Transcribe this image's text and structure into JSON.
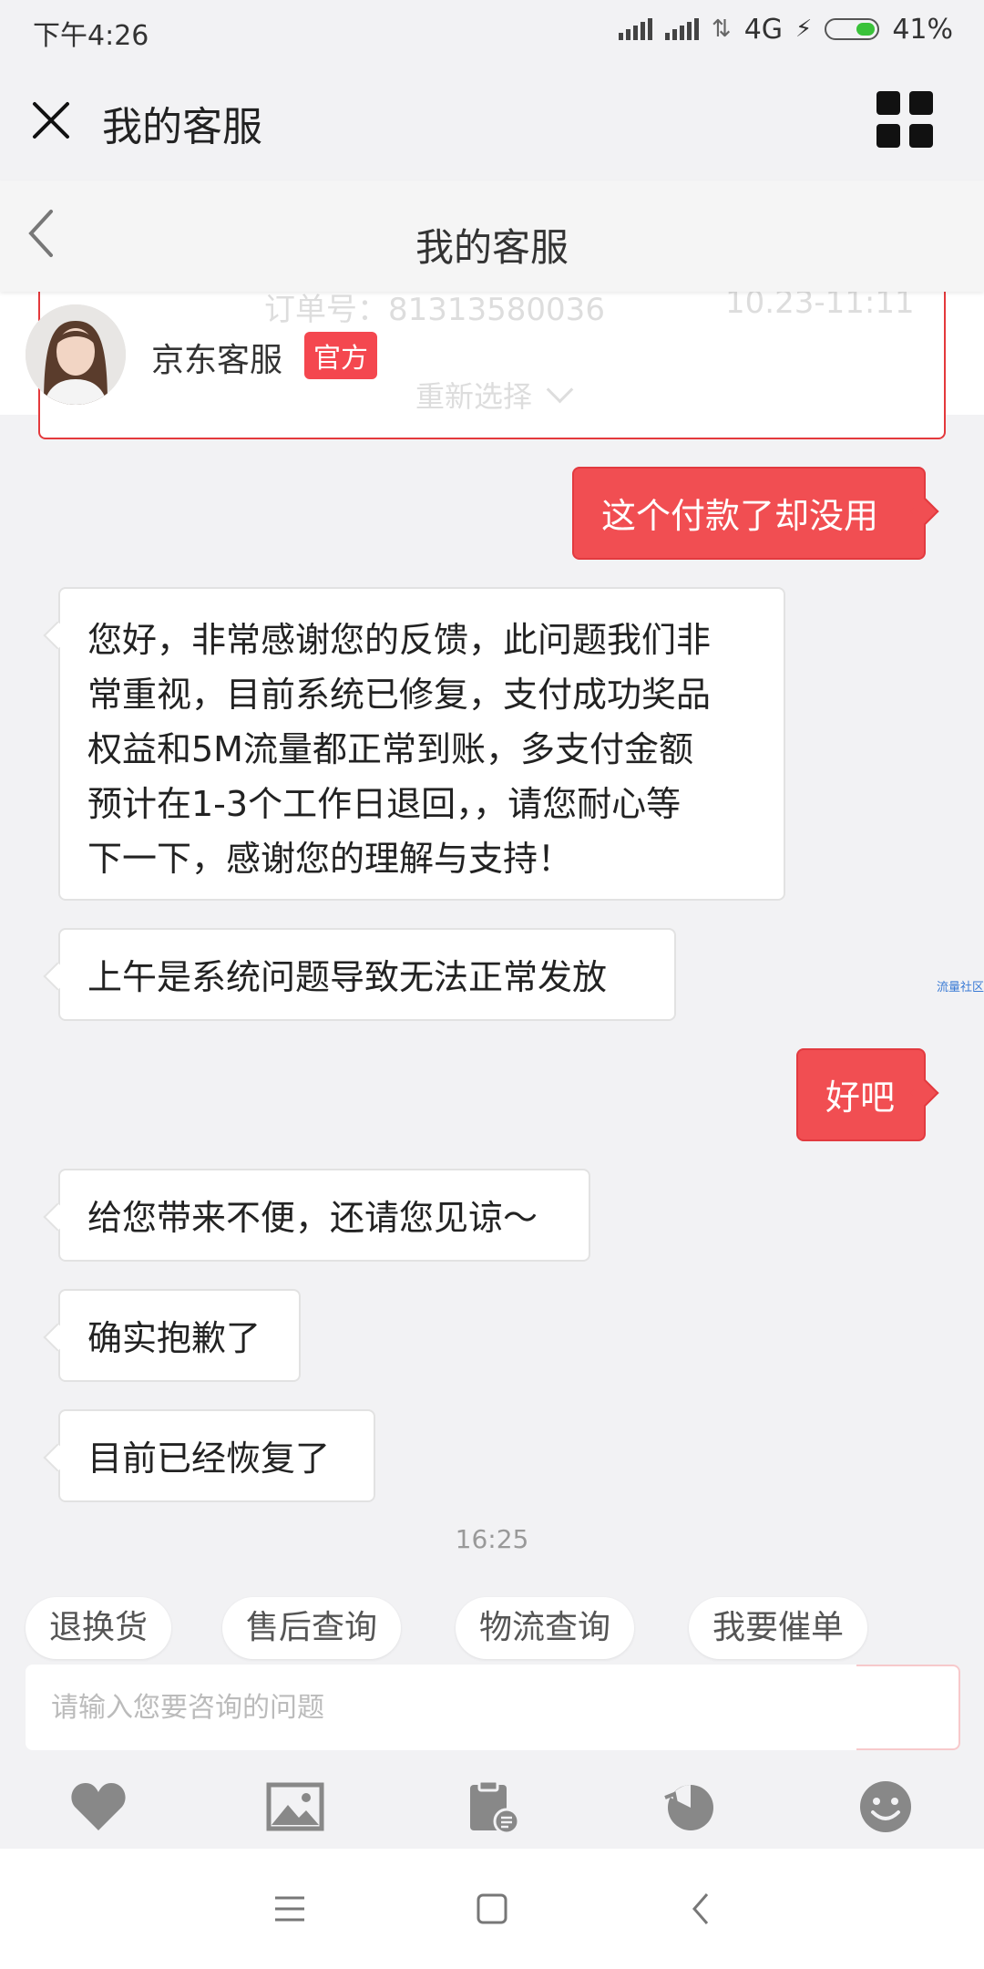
{
  "status_bar": {
    "time": "下午4:26",
    "network": "4G",
    "battery": "41%"
  },
  "top_bar": {
    "title": "我的客服"
  },
  "inner_header": {
    "title": "我的客服"
  },
  "order_card": {
    "order_no": "订单号：81313580036",
    "time": "10.23-11:11",
    "reselect": "重新选择"
  },
  "agent": {
    "name": "京东客服",
    "badge": "官方"
  },
  "messages": [
    {
      "from": "user",
      "text": "这个付款了却没用"
    },
    {
      "from": "agent",
      "lines": [
        "您好，非常感谢您的反馈，此问题我们非",
        "常重视，目前系统已修复，支付成功奖品",
        "权益和5M流量都正常到账，多支付金额",
        "预计在1-3个工作日退回，，请您耐心等",
        "下一下，感谢您的理解与支持！"
      ]
    },
    {
      "from": "agent",
      "text": "上午是系统问题导致无法正常发放"
    },
    {
      "from": "user",
      "text": "好吧"
    },
    {
      "from": "agent",
      "text": "给您带来不便，还请您见谅～"
    },
    {
      "from": "agent",
      "text": "确实抱歉了"
    },
    {
      "from": "agent",
      "text": "目前已经恢复了"
    }
  ],
  "watermark": "流量社区",
  "timestamp": "16:25",
  "quick_replies": [
    "退换货",
    "售后查询",
    "物流查询",
    "我要催单"
  ],
  "input": {
    "placeholder": "请输入您要咨询的问题"
  },
  "toolbar_icons": [
    "heart-icon",
    "image-icon",
    "clipboard-icon",
    "history-icon",
    "emoji-icon"
  ],
  "nav_icons": [
    "menu-icon",
    "home-icon",
    "back-icon"
  ],
  "colors": {
    "accent": "#f14e52",
    "background": "#f2f2f4",
    "official_badge": "#f4474f"
  }
}
